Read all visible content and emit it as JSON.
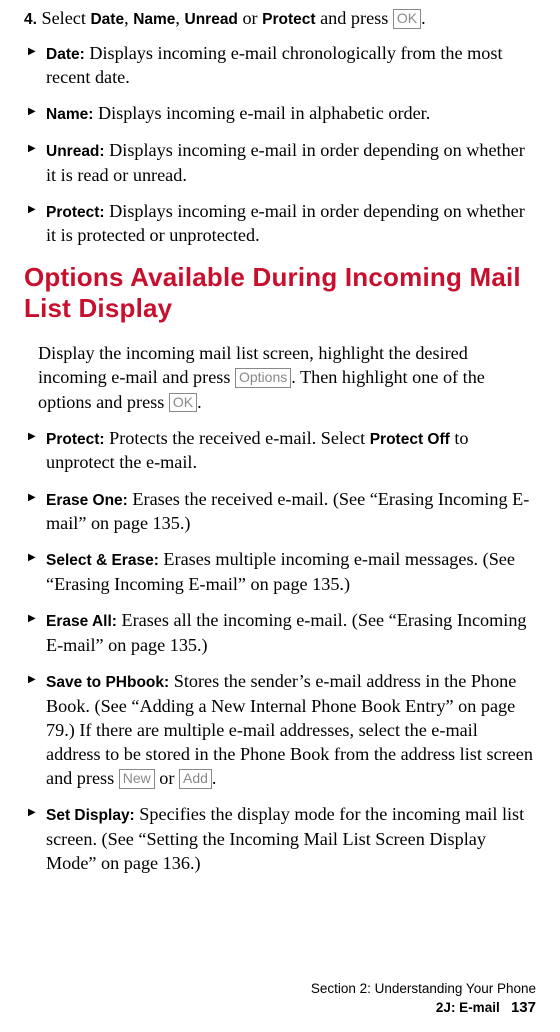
{
  "step4": {
    "num": "4.",
    "pre": "Select ",
    "opt1": "Date",
    "sep1": ", ",
    "opt2": "Name",
    "sep2": ", ",
    "opt3": "Unread",
    "sep3": " or ",
    "opt4": "Protect",
    "post": " and press ",
    "key": "OK",
    "end": "."
  },
  "sortBullets": [
    {
      "label": "Date:",
      "desc": " Displays incoming e-mail chronologically from the most recent date."
    },
    {
      "label": "Name:",
      "desc": " Displays incoming e-mail in alphabetic order."
    },
    {
      "label": "Unread:",
      "desc": " Displays incoming e-mail in order depending on whether it is read or unread."
    },
    {
      "label": "Protect:",
      "desc": " Displays incoming e-mail in order depending on whether it is protected or unprotected."
    }
  ],
  "heading": "Options Available During Incoming Mail List Display",
  "intro": {
    "t1": "Display the incoming mail list screen, highlight the desired incoming e-mail and press ",
    "key1": "Options",
    "t2": ". Then highlight one of the options and press ",
    "key2": "OK",
    "t3": "."
  },
  "optionBullets": {
    "b0": {
      "label": "Protect:",
      "t1": " Protects the received e-mail. Select ",
      "bold": "Protect Off",
      "t2": " to unprotect the e-mail."
    },
    "b1": {
      "label": "Erase One:",
      "t": " Erases the received e-mail. (See “Erasing Incoming E-mail” on page 135.)"
    },
    "b2": {
      "label": "Select & Erase:",
      "t": " Erases multiple incoming e-mail messages. (See “Erasing Incoming E-mail” on page 135.)"
    },
    "b3": {
      "label": "Erase All:",
      "t": " Erases all the incoming e-mail. (See “Erasing Incoming E-mail” on page 135.)"
    },
    "b4": {
      "label": "Save to PHbook:",
      "t1": " Stores the sender’s e-mail address in the Phone Book. (See “Adding a New Internal Phone Book Entry” on page 79.) If there are multiple e-mail addresses, select the e-mail address to be stored in the Phone Book from the address list screen and press ",
      "key1": "New",
      "t2": " or ",
      "key2": "Add",
      "t3": "."
    },
    "b5": {
      "label": "Set Display:",
      "t": " Specifies the display mode for the incoming mail list screen. (See “Setting the Incoming Mail List Screen Display Mode” on page 136.)"
    }
  },
  "footer": {
    "line1": "Section 2: Understanding Your Phone",
    "line2a": "2J: E-mail",
    "line2b": "137"
  }
}
